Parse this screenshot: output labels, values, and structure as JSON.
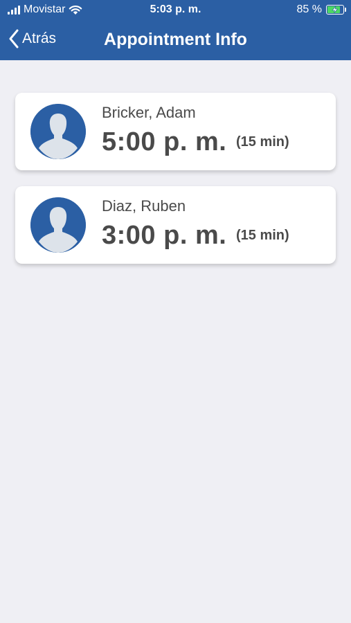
{
  "status_bar": {
    "carrier": "Movistar",
    "time": "5:03 p. m.",
    "battery": "85 %",
    "battery_level": 0.85
  },
  "nav": {
    "back_label": "Atrás",
    "title": "Appointment Info"
  },
  "appointments": [
    {
      "name": "Bricker, Adam",
      "time": "5:00 p. m.",
      "duration": "(15 min)"
    },
    {
      "name": "Diaz, Ruben",
      "time": "3:00 p. m.",
      "duration": "(15 min)"
    }
  ],
  "colors": {
    "header": "#2b5fa4",
    "background": "#efeff4",
    "avatar_bg": "#2b5fa4",
    "avatar_silhouette": "#dde3ea",
    "battery_charge": "#4cd964"
  }
}
